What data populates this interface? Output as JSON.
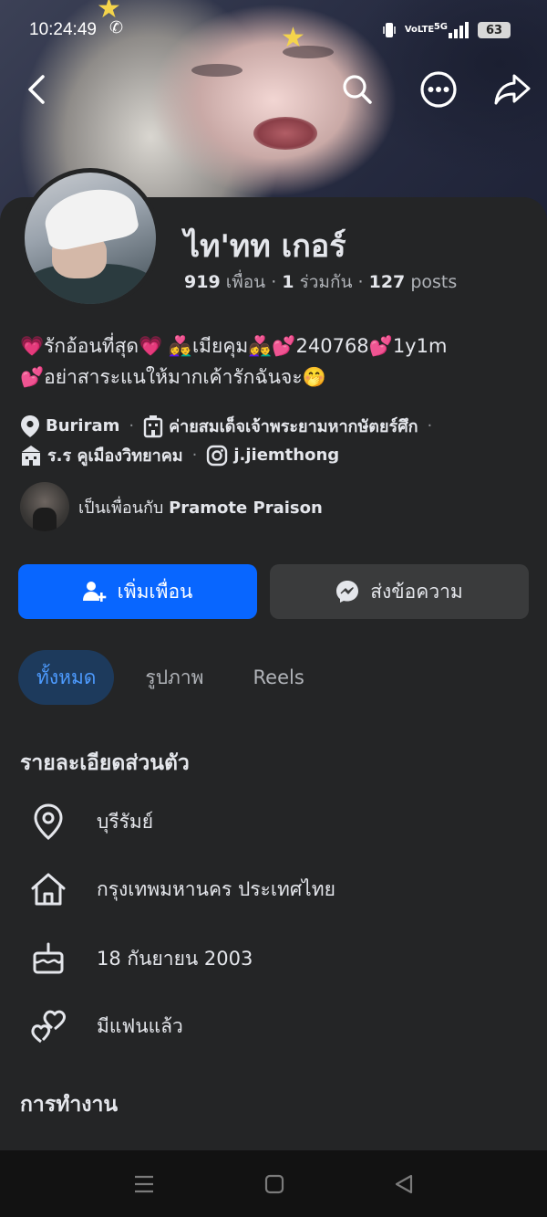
{
  "status": {
    "time": "10:24:49",
    "network": "VoLTE",
    "band": "5G",
    "battery": "63"
  },
  "profile": {
    "name": "ไท'ทท เกอร์",
    "stats": {
      "friends_count": "919",
      "friends_label": "เพื่อน",
      "mutual_count": "1",
      "mutual_label": "ร่วมกัน",
      "posts_count": "127",
      "posts_label": "posts"
    },
    "bio": {
      "line1": "💗รักอ้อนที่สุด💗 👩‍❤️‍👨เมียคุม👩‍❤️‍👨💕240768💕1y1m",
      "line2": "💕อย่าสาระแนให้มากเค้ารักฉันจะ🤭"
    },
    "location": "Buriram",
    "workplace": "ค่ายสมเด็จเจ้าพระยามหากษัตยร์ศึก",
    "school": "ร.ร คูเมืองวิทยาคม",
    "instagram": "j.jiemthong",
    "friends_with_prefix": "เป็นเพื่อนกับ",
    "friends_with_name": "Pramote Praison"
  },
  "actions": {
    "add_friend": "เพิ่มเพื่อน",
    "message": "ส่งข้อความ"
  },
  "tabs": [
    {
      "label": "ทั้งหมด"
    },
    {
      "label": "รูปภาพ"
    },
    {
      "label": "Reels"
    }
  ],
  "details": {
    "title": "รายละเอียดส่วนตัว",
    "lives_in": "บุรีรัมย์",
    "hometown": "กรุงเทพมหานคร ประเทศไทย",
    "birthday": "18 กันยายน  2003",
    "relationship": "มีแฟนแล้ว"
  },
  "work": {
    "title": "การทำงาน"
  },
  "colors": {
    "accent": "#0866ff",
    "background": "#242526",
    "button_secondary": "#3a3b3c"
  }
}
